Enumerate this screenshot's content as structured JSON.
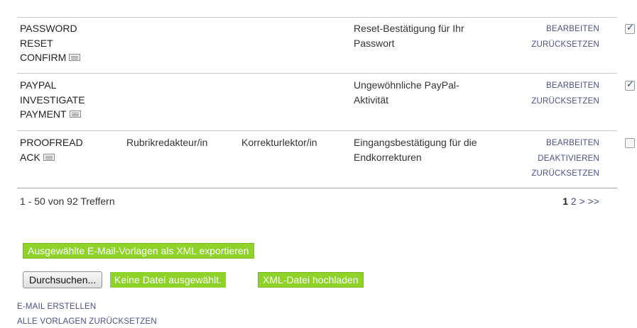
{
  "table": {
    "rows": [
      {
        "key_lines": [
          "PASSWORD",
          "RESET",
          "CONFIRM"
        ],
        "sender": "",
        "recipient": "",
        "description_lines": [
          "Reset-Bestätigung für Ihr",
          "Passwort"
        ],
        "actions": [
          "BEARBEITEN",
          "ZURÜCKSETZEN"
        ],
        "checked": true
      },
      {
        "key_lines": [
          "PAYPAL",
          "INVESTIGATE",
          "PAYMENT"
        ],
        "sender": "",
        "recipient": "",
        "description_lines": [
          "Ungewöhnliche PayPal-",
          "Aktivität"
        ],
        "actions": [
          "BEARBEITEN",
          "ZURÜCKSETZEN"
        ],
        "checked": true
      },
      {
        "key_lines": [
          "PROOFREAD",
          "ACK"
        ],
        "sender": "Rubrikredakteur/in",
        "recipient": "Korrekturlektor/in",
        "description_lines": [
          "Eingangsbestätigung für die",
          "Endkorrekturen"
        ],
        "actions": [
          "BEARBEITEN",
          "DEAKTIVIEREN",
          "ZURÜCKSETZEN"
        ],
        "checked": false
      }
    ]
  },
  "pagination": {
    "info": "1 - 50 von 92 Treffern",
    "current": "1",
    "rest": "2 > >>"
  },
  "buttons": {
    "export": "Ausgewählte E-Mail-Vorlagen als XML exportieren",
    "browse": "Durchsuchen...",
    "no_file": "Keine Datei ausgewählt.",
    "upload": "XML-Datei hochladen"
  },
  "links": {
    "create": "E-MAIL ERSTELLEN",
    "reset_all": "ALLE VORLAGEN ZURÜCKSETZEN"
  },
  "colors": {
    "accent_green": "#8ed22a",
    "link": "#4a4f8a"
  }
}
